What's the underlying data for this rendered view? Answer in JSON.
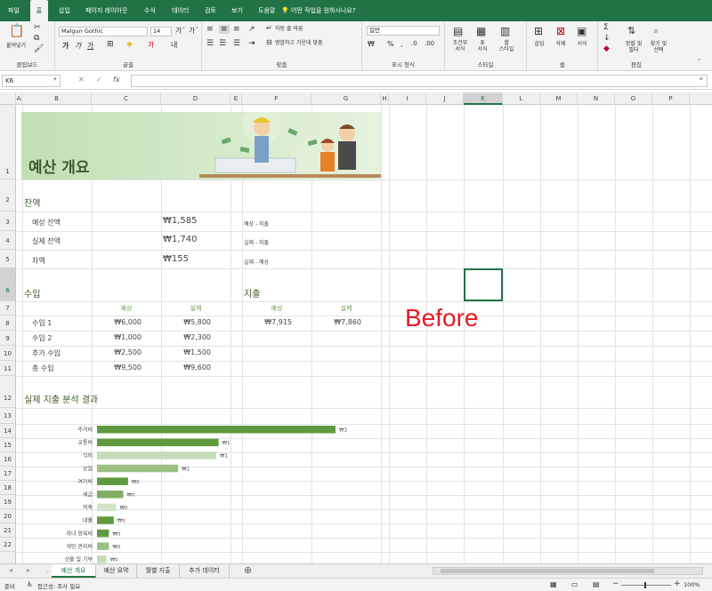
{
  "ribbon_tabs": [
    "파일",
    "홈",
    "삽입",
    "페이지 레이아웃",
    "수식",
    "데이터",
    "검토",
    "보기",
    "도움말"
  ],
  "tell_me": "어떤 작업을 원하시나요?",
  "ribbon": {
    "paste": "붙여넣기",
    "font_name": "Malgun Gothic",
    "font_size": "14",
    "wrap_text": "자동 줄 바꿈",
    "merge_center": "병합하고 가운데 맞춤",
    "number_format": "일반",
    "cond_format": "조건부\n서식",
    "format_table": "표\n서식",
    "cell_styles": "셀\n스타일",
    "insert": "삽입",
    "delete": "삭제",
    "format": "서식",
    "sort_filter": "정렬 및\n필터",
    "find_select": "찾기 및\n선택",
    "groups": {
      "clipboard": "클립보드",
      "font": "글꼴",
      "align": "맞춤",
      "number": "표시 형식",
      "styles": "스타일",
      "cells": "셀",
      "editing": "편집"
    }
  },
  "formula": {
    "name_box": "K6",
    "fx": "fx"
  },
  "columns": [
    "A",
    "B",
    "C",
    "D",
    "E",
    "F",
    "G",
    "H",
    "I",
    "J",
    "K",
    "L",
    "M",
    "N",
    "O",
    "P"
  ],
  "rows": [
    "1",
    "2",
    "3",
    "4",
    "5",
    "6",
    "7",
    "8",
    "9",
    "10",
    "11",
    "12",
    "13",
    "14",
    "15",
    "16",
    "17",
    "18",
    "19",
    "20",
    "21",
    "22"
  ],
  "sheet": {
    "title": "예산 개요",
    "balance": {
      "heading": "잔액",
      "rows": [
        {
          "label": "예상 잔액",
          "value": "₩1,585",
          "note": "예상 - 지출"
        },
        {
          "label": "실제 잔액",
          "value": "₩1,740",
          "note": "실제 - 지출"
        },
        {
          "label": "차액",
          "value": "₩155",
          "note": "실제 - 예상"
        }
      ]
    },
    "income": {
      "heading": "수입",
      "col_expected": "예상",
      "col_actual": "실제",
      "rows": [
        {
          "label": "수입 1",
          "expected": "₩6,000",
          "actual": "₩5,800"
        },
        {
          "label": "수입 2",
          "expected": "₩1,000",
          "actual": "₩2,300"
        },
        {
          "label": "추가 수입",
          "expected": "₩2,500",
          "actual": "₩1,500"
        },
        {
          "label": "총 수입",
          "expected": "₩9,500",
          "actual": "₩9,600"
        }
      ]
    },
    "expense": {
      "heading": "지출",
      "col_expected": "예상",
      "col_actual": "실제",
      "expected": "₩7,915",
      "actual": "₩7,860"
    },
    "analysis_heading": "실제 지출 분석 결과",
    "annotation": "Before"
  },
  "chart_data": {
    "type": "bar",
    "orientation": "horizontal",
    "categories": [
      "주거비",
      "교통비",
      "식비",
      "보험",
      "여가비",
      "세금",
      "저축",
      "대출",
      "자녀 양육비",
      "개인 관리비",
      "선물 및 기부"
    ],
    "values": [
      3,
      1,
      1,
      1,
      0,
      0,
      0,
      0,
      0,
      0,
      0
    ],
    "data_labels": [
      "₩3",
      "₩1",
      "₩1",
      "₩1",
      "₩0",
      "₩0",
      "₩0",
      "₩0",
      "₩0",
      "₩0",
      "₩0"
    ],
    "bar_lengths_relative": [
      1.0,
      0.51,
      0.5,
      0.34,
      0.13,
      0.11,
      0.08,
      0.07,
      0.05,
      0.05,
      0.04
    ],
    "colors": [
      "#5f9a3f",
      "#5f9a3f",
      "#c6dcb8",
      "#9cc084",
      "#5f9a3f",
      "#7fae62",
      "#d3e3c8",
      "#5f9a3f",
      "#5f9a3f",
      "#9cc084",
      "#c6dcb8"
    ]
  },
  "sheet_tabs": [
    "예산 개요",
    "예산 요약",
    "월별 지출",
    "추가 데이터"
  ],
  "status": {
    "ready": "준비",
    "accessibility": "접근성: 조사 필요",
    "zoom": "100%"
  },
  "colors": {
    "accent": "#217346",
    "title": "#3d5a2b",
    "annotation": "#e31b23"
  }
}
